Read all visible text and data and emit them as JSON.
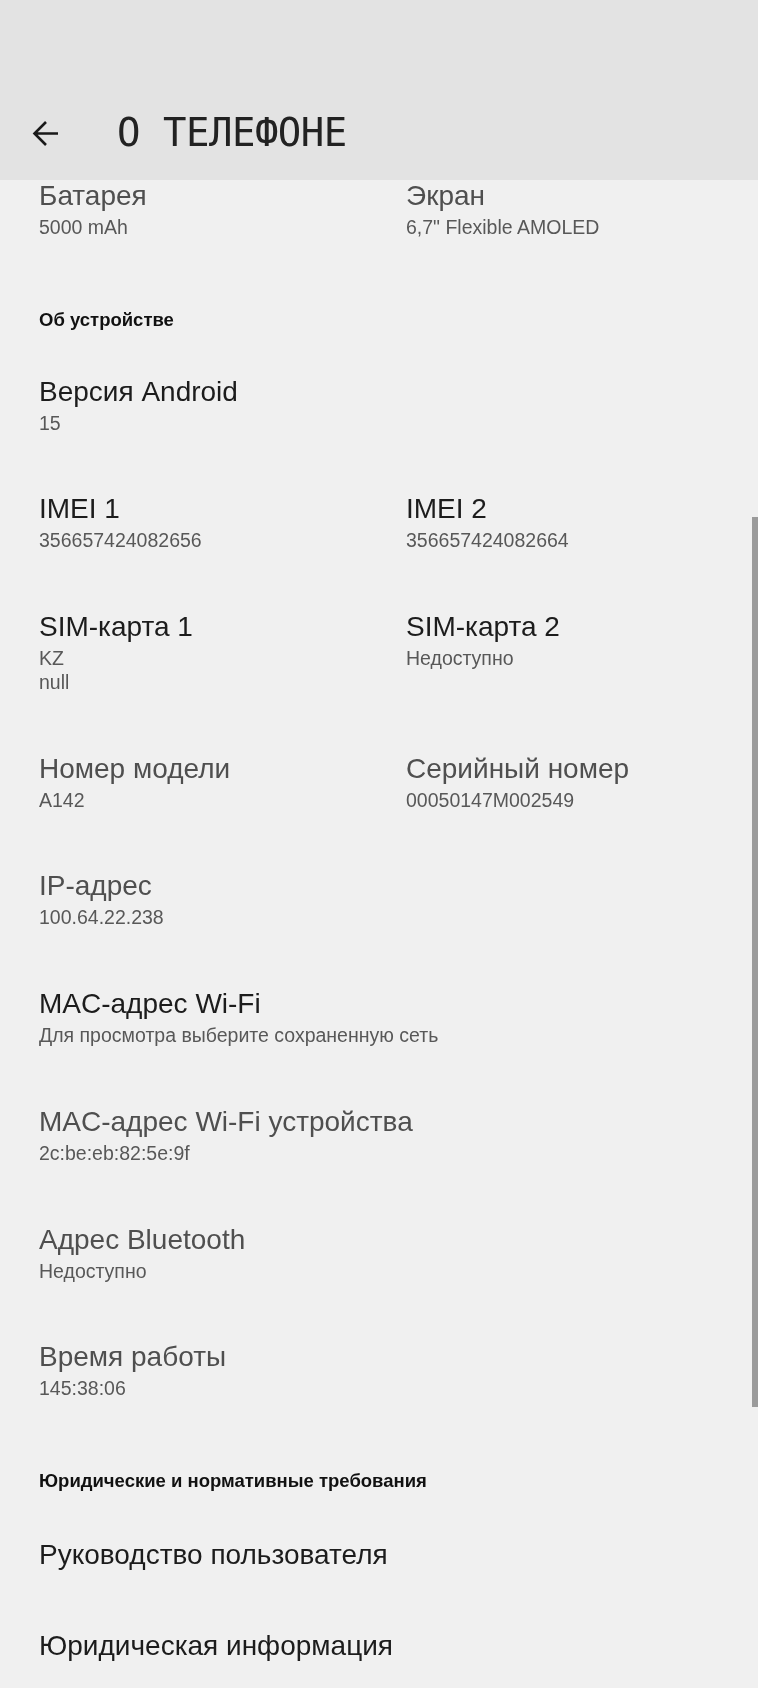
{
  "header": {
    "title": "О ТЕЛЕФОНЕ"
  },
  "sections": [
    {
      "rows": [
        {
          "items": [
            {
              "title": "Батарея",
              "values": [
                "5000 mAh"
              ],
              "disabled": true
            },
            {
              "title": "Экран",
              "values": [
                "6,7\" Flexible AMOLED"
              ],
              "disabled": true
            }
          ]
        }
      ]
    },
    {
      "heading": "Об устройстве",
      "rows": [
        {
          "items": [
            {
              "title": "Версия Android",
              "values": [
                "15"
              ],
              "disabled": false
            }
          ]
        },
        {
          "items": [
            {
              "title": "IMEI 1",
              "values": [
                "356657424082656"
              ],
              "disabled": false
            },
            {
              "title": "IMEI 2",
              "values": [
                "356657424082664"
              ],
              "disabled": false
            }
          ]
        },
        {
          "items": [
            {
              "title": "SIM-карта 1",
              "values": [
                "KZ",
                "null"
              ],
              "disabled": false
            },
            {
              "title": "SIM-карта 2",
              "values": [
                "Недоступно"
              ],
              "disabled": false
            }
          ]
        },
        {
          "items": [
            {
              "title": "Номер модели",
              "values": [
                "A142"
              ],
              "disabled": true
            },
            {
              "title": "Серийный номер",
              "values": [
                "00050147M002549"
              ],
              "disabled": true
            }
          ]
        },
        {
          "items": [
            {
              "title": "IP-адрес",
              "values": [
                "100.64.22.238"
              ],
              "disabled": true
            }
          ]
        },
        {
          "items": [
            {
              "title": "MAC-адрес Wi-Fi",
              "values": [
                "Для просмотра выберите сохраненную сеть"
              ],
              "disabled": false
            }
          ]
        },
        {
          "items": [
            {
              "title": "MAC-адрес Wi-Fi устройства",
              "values": [
                "2c:be:eb:82:5e:9f"
              ],
              "disabled": true
            }
          ]
        },
        {
          "items": [
            {
              "title": "Адрес Bluetooth",
              "values": [
                "Недоступно"
              ],
              "disabled": true
            }
          ]
        },
        {
          "items": [
            {
              "title": "Время работы",
              "values": [
                "145:38:06"
              ],
              "disabled": true
            }
          ]
        }
      ]
    },
    {
      "heading": "Юридические и нормативные требования",
      "rows": [
        {
          "items": [
            {
              "title": "Руководство пользователя",
              "disabled": false
            }
          ]
        },
        {
          "items": [
            {
              "title": "Юридическая информация",
              "disabled": false
            }
          ]
        }
      ]
    }
  ]
}
